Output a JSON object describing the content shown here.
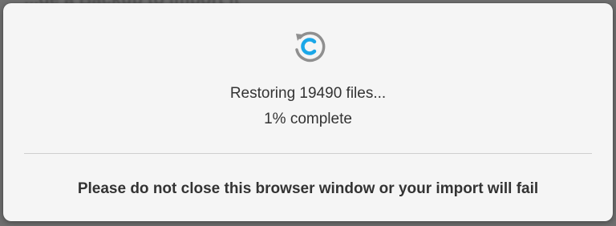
{
  "backdrop": {
    "partial_text": "...de a Backup to import it"
  },
  "dialog": {
    "icon": "restore-icon",
    "accent_color": "#1aa7e8",
    "status_text": "Restoring 19490 files...",
    "progress_text": "1% complete",
    "warning_text": "Please do not close this browser window or your import will fail"
  }
}
